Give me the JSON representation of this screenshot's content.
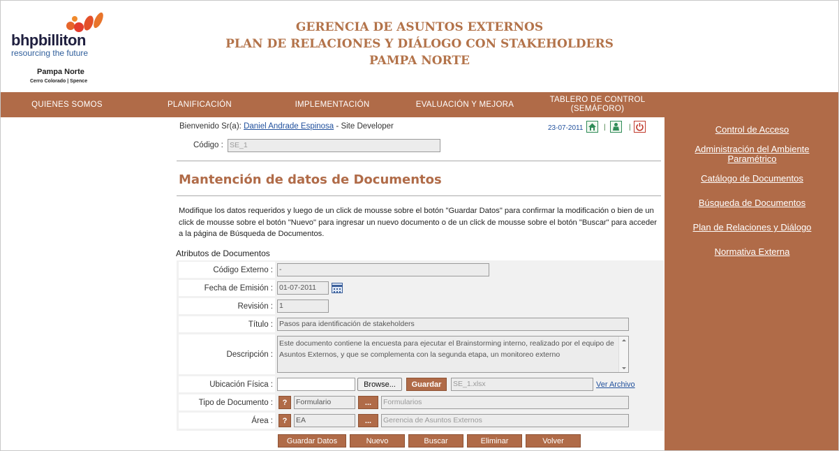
{
  "header": {
    "logo_word": "bhpbilliton",
    "logo_tagline": "resourcing the future",
    "logo_site": "Pampa Norte",
    "logo_subsite": "Cerro Colorado | Spence",
    "title_lines": [
      "GERENCIA DE ASUNTOS EXTERNOS",
      "PLAN DE RELACIONES Y DIÁLOGO CON STAKEHOLDERS",
      "PAMPA NORTE"
    ]
  },
  "nav": {
    "items": [
      "QUIENES SOMOS",
      "PLANIFICACIÓN",
      "IMPLEMENTACIÓN",
      "EVALUACIÓN Y MEJORA",
      "TABLERO DE CONTROL (SEMÁFORO)"
    ]
  },
  "sidebar": {
    "links": [
      "Control de Acceso",
      "Administración del Ambiente Paramétrico",
      "Catálogo de Documentos",
      "Búsqueda de Documentos",
      "Plan de Relaciones y Diálogo",
      "Normativa Externa"
    ]
  },
  "user_bar": {
    "welcome_prefix": "Bienvenido Sr(a):",
    "user_name": "Daniel Andrade Espinosa",
    "role": "- Site Developer",
    "date": "23-07-2011",
    "icons": [
      "home-icon",
      "user-icon",
      "power-icon"
    ]
  },
  "codigo": {
    "label": "Código :",
    "value": "SE_1"
  },
  "page_title": "Mantención de datos de Documentos",
  "instructions": "Modifique los datos requeridos y luego de un click de mousse sobre el botón \"Guardar Datos\" para confirmar la modificación o bien de un click de mousse sobre el botón \"Nuevo\" para ingresar un nuevo documento o de un click de mousse sobre el botón \"Buscar\" para acceder a la página de Búsqueda de Documentos.",
  "form": {
    "section": "Atributos de Documentos",
    "codigo_externo": {
      "label": "Código Externo :",
      "value": "-"
    },
    "fecha_emision": {
      "label": "Fecha de Emisión :",
      "value": "01-07-2011"
    },
    "revision": {
      "label": "Revisión :",
      "value": "1"
    },
    "titulo": {
      "label": "Título :",
      "value": "Pasos para identificación de stakeholders"
    },
    "descripcion": {
      "label": "Descripción :",
      "value": "Este documento contiene la encuesta para ejecutar el Brainstorming interno, realizado por el equipo de Asuntos Externos, y que se complementa con la segunda etapa, un monitoreo externo"
    },
    "ubicacion": {
      "label": "Ubicación Física :",
      "file_value": "",
      "browse_label": "Browse...",
      "save_label": "Guardar",
      "stored_file": "SE_1.xlsx",
      "view_link": "Ver Archivo"
    },
    "tipo_documento": {
      "label": "Tipo de Documento :",
      "help": "?",
      "code": "Formulario",
      "lookup": "...",
      "description": "Formularios"
    },
    "area": {
      "label": "Área :",
      "help": "?",
      "code": "EA",
      "lookup": "...",
      "description": "Gerencia de Asuntos Externos"
    }
  },
  "actions": [
    "Guardar Datos",
    "Nuevo",
    "Buscar",
    "Eliminar",
    "Volver"
  ],
  "colors": {
    "brand": "#b06b48",
    "title": "#b3734a",
    "link": "#1f4f9c"
  }
}
